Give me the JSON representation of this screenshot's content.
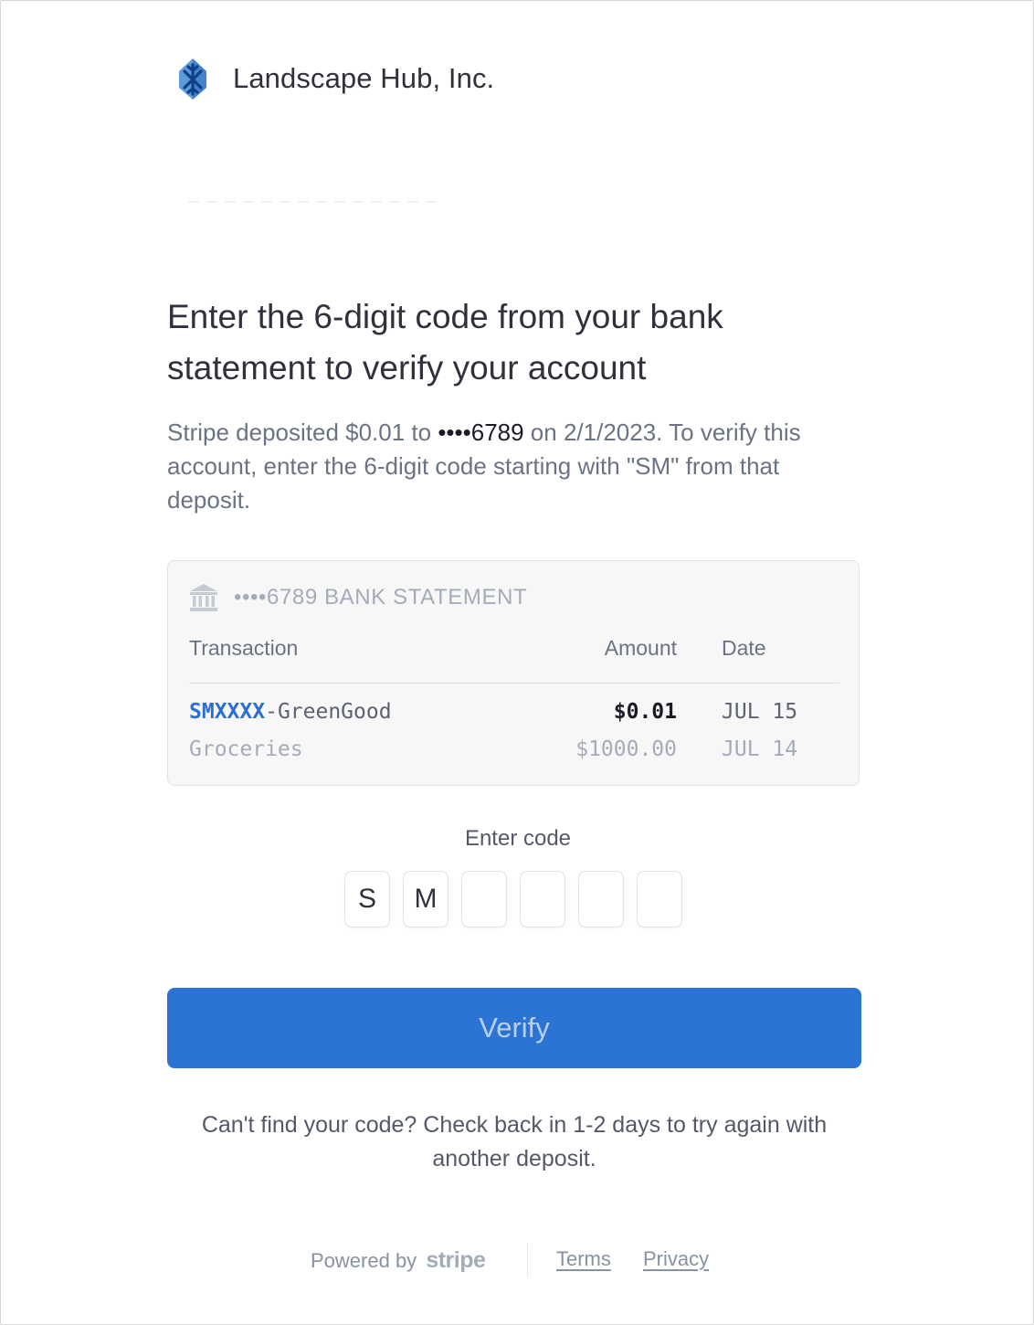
{
  "brand": {
    "name": "Landscape Hub, Inc.",
    "logo_icon": "snowflake-leaf-logo-icon",
    "logo_color": "#3b82c4"
  },
  "heading": {
    "title": "Enter the 6-digit code from your bank statement to verify your account",
    "desc_prefix": "Stripe deposited $0.01 to ",
    "desc_account": "••••6789",
    "desc_suffix": " on 2/1/2023. To verify this account, enter the 6-digit code starting with \"SM\" from that deposit."
  },
  "statement": {
    "icon": "bank-icon",
    "title": "••••6789 BANK STATEMENT",
    "columns": {
      "transaction": "Transaction",
      "amount": "Amount",
      "date": "Date"
    },
    "rows": [
      {
        "code_prefix": "SMXXXX",
        "description": "-GreenGood",
        "amount": "$0.01",
        "date": "JUL 15"
      },
      {
        "code_prefix": "",
        "description": "Groceries",
        "amount": "$1000.00",
        "date": "JUL 14"
      }
    ]
  },
  "code_entry": {
    "label": "Enter code",
    "digits": [
      "S",
      "M",
      "",
      "",
      "",
      ""
    ]
  },
  "verify_button": {
    "label": "Verify",
    "color": "#2c74d3"
  },
  "help_text": "Can't find your code? Check back in 1-2 days to try again with another deposit.",
  "footer": {
    "powered_by": "Powered by",
    "stripe": "stripe",
    "terms": "Terms",
    "privacy": "Privacy"
  }
}
